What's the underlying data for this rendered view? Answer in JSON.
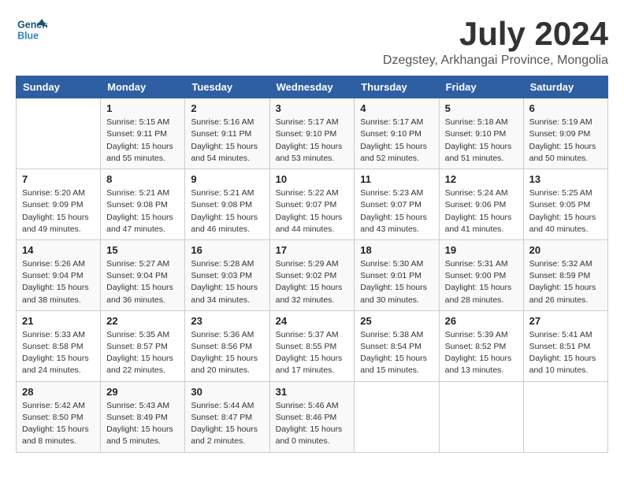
{
  "logo": {
    "line1": "General",
    "line2": "Blue"
  },
  "title": {
    "month_year": "July 2024",
    "location": "Dzegstey, Arkhangai Province, Mongolia"
  },
  "header": {
    "days": [
      "Sunday",
      "Monday",
      "Tuesday",
      "Wednesday",
      "Thursday",
      "Friday",
      "Saturday"
    ]
  },
  "weeks": [
    [
      {
        "day": "",
        "info": ""
      },
      {
        "day": "1",
        "info": "Sunrise: 5:15 AM\nSunset: 9:11 PM\nDaylight: 15 hours\nand 55 minutes."
      },
      {
        "day": "2",
        "info": "Sunrise: 5:16 AM\nSunset: 9:11 PM\nDaylight: 15 hours\nand 54 minutes."
      },
      {
        "day": "3",
        "info": "Sunrise: 5:17 AM\nSunset: 9:10 PM\nDaylight: 15 hours\nand 53 minutes."
      },
      {
        "day": "4",
        "info": "Sunrise: 5:17 AM\nSunset: 9:10 PM\nDaylight: 15 hours\nand 52 minutes."
      },
      {
        "day": "5",
        "info": "Sunrise: 5:18 AM\nSunset: 9:10 PM\nDaylight: 15 hours\nand 51 minutes."
      },
      {
        "day": "6",
        "info": "Sunrise: 5:19 AM\nSunset: 9:09 PM\nDaylight: 15 hours\nand 50 minutes."
      }
    ],
    [
      {
        "day": "7",
        "info": "Sunrise: 5:20 AM\nSunset: 9:09 PM\nDaylight: 15 hours\nand 49 minutes."
      },
      {
        "day": "8",
        "info": "Sunrise: 5:21 AM\nSunset: 9:08 PM\nDaylight: 15 hours\nand 47 minutes."
      },
      {
        "day": "9",
        "info": "Sunrise: 5:21 AM\nSunset: 9:08 PM\nDaylight: 15 hours\nand 46 minutes."
      },
      {
        "day": "10",
        "info": "Sunrise: 5:22 AM\nSunset: 9:07 PM\nDaylight: 15 hours\nand 44 minutes."
      },
      {
        "day": "11",
        "info": "Sunrise: 5:23 AM\nSunset: 9:07 PM\nDaylight: 15 hours\nand 43 minutes."
      },
      {
        "day": "12",
        "info": "Sunrise: 5:24 AM\nSunset: 9:06 PM\nDaylight: 15 hours\nand 41 minutes."
      },
      {
        "day": "13",
        "info": "Sunrise: 5:25 AM\nSunset: 9:05 PM\nDaylight: 15 hours\nand 40 minutes."
      }
    ],
    [
      {
        "day": "14",
        "info": "Sunrise: 5:26 AM\nSunset: 9:04 PM\nDaylight: 15 hours\nand 38 minutes."
      },
      {
        "day": "15",
        "info": "Sunrise: 5:27 AM\nSunset: 9:04 PM\nDaylight: 15 hours\nand 36 minutes."
      },
      {
        "day": "16",
        "info": "Sunrise: 5:28 AM\nSunset: 9:03 PM\nDaylight: 15 hours\nand 34 minutes."
      },
      {
        "day": "17",
        "info": "Sunrise: 5:29 AM\nSunset: 9:02 PM\nDaylight: 15 hours\nand 32 minutes."
      },
      {
        "day": "18",
        "info": "Sunrise: 5:30 AM\nSunset: 9:01 PM\nDaylight: 15 hours\nand 30 minutes."
      },
      {
        "day": "19",
        "info": "Sunrise: 5:31 AM\nSunset: 9:00 PM\nDaylight: 15 hours\nand 28 minutes."
      },
      {
        "day": "20",
        "info": "Sunrise: 5:32 AM\nSunset: 8:59 PM\nDaylight: 15 hours\nand 26 minutes."
      }
    ],
    [
      {
        "day": "21",
        "info": "Sunrise: 5:33 AM\nSunset: 8:58 PM\nDaylight: 15 hours\nand 24 minutes."
      },
      {
        "day": "22",
        "info": "Sunrise: 5:35 AM\nSunset: 8:57 PM\nDaylight: 15 hours\nand 22 minutes."
      },
      {
        "day": "23",
        "info": "Sunrise: 5:36 AM\nSunset: 8:56 PM\nDaylight: 15 hours\nand 20 minutes."
      },
      {
        "day": "24",
        "info": "Sunrise: 5:37 AM\nSunset: 8:55 PM\nDaylight: 15 hours\nand 17 minutes."
      },
      {
        "day": "25",
        "info": "Sunrise: 5:38 AM\nSunset: 8:54 PM\nDaylight: 15 hours\nand 15 minutes."
      },
      {
        "day": "26",
        "info": "Sunrise: 5:39 AM\nSunset: 8:52 PM\nDaylight: 15 hours\nand 13 minutes."
      },
      {
        "day": "27",
        "info": "Sunrise: 5:41 AM\nSunset: 8:51 PM\nDaylight: 15 hours\nand 10 minutes."
      }
    ],
    [
      {
        "day": "28",
        "info": "Sunrise: 5:42 AM\nSunset: 8:50 PM\nDaylight: 15 hours\nand 8 minutes."
      },
      {
        "day": "29",
        "info": "Sunrise: 5:43 AM\nSunset: 8:49 PM\nDaylight: 15 hours\nand 5 minutes."
      },
      {
        "day": "30",
        "info": "Sunrise: 5:44 AM\nSunset: 8:47 PM\nDaylight: 15 hours\nand 2 minutes."
      },
      {
        "day": "31",
        "info": "Sunrise: 5:46 AM\nSunset: 8:46 PM\nDaylight: 15 hours\nand 0 minutes."
      },
      {
        "day": "",
        "info": ""
      },
      {
        "day": "",
        "info": ""
      },
      {
        "day": "",
        "info": ""
      }
    ]
  ]
}
